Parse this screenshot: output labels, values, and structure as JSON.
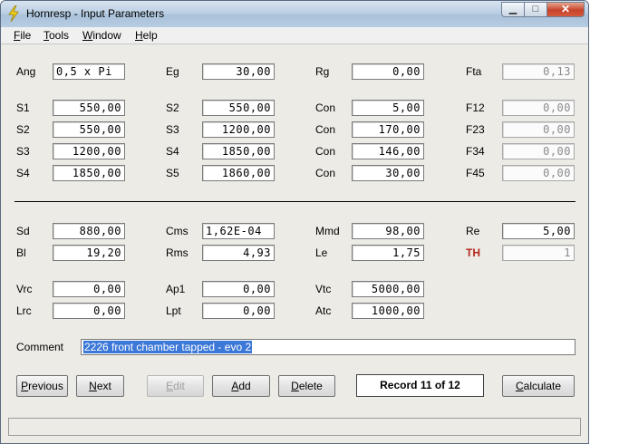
{
  "window": {
    "title": "Hornresp - Input Parameters",
    "min_glyph": "▁",
    "max_glyph": "□",
    "close_glyph": "✕"
  },
  "menu": [
    {
      "accel": "F",
      "rest": "ile"
    },
    {
      "accel": "T",
      "rest": "ools"
    },
    {
      "accel": "W",
      "rest": "indow"
    },
    {
      "accel": "H",
      "rest": "elp"
    }
  ],
  "rows": [
    [
      {
        "label": "Ang",
        "value": "0,5 x Pi",
        "align": "left"
      },
      {
        "label": "Eg",
        "value": "30,00"
      },
      {
        "label": "Rg",
        "value": "0,00"
      },
      {
        "label": "Fta",
        "value": "0,13",
        "readonly": true
      }
    ],
    [
      {
        "label": "S1",
        "value": "550,00"
      },
      {
        "label": "S2",
        "value": "550,00"
      },
      {
        "label": "Con",
        "value": "5,00"
      },
      {
        "label": "F12",
        "value": "0,00",
        "readonly": true
      }
    ],
    [
      {
        "label": "S2",
        "value": "550,00"
      },
      {
        "label": "S3",
        "value": "1200,00"
      },
      {
        "label": "Con",
        "value": "170,00"
      },
      {
        "label": "F23",
        "value": "0,00",
        "readonly": true
      }
    ],
    [
      {
        "label": "S3",
        "value": "1200,00"
      },
      {
        "label": "S4",
        "value": "1850,00"
      },
      {
        "label": "Con",
        "value": "146,00"
      },
      {
        "label": "F34",
        "value": "0,00",
        "readonly": true
      }
    ],
    [
      {
        "label": "S4",
        "value": "1850,00"
      },
      {
        "label": "S5",
        "value": "1860,00"
      },
      {
        "label": "Con",
        "value": "30,00"
      },
      {
        "label": "F45",
        "value": "0,00",
        "readonly": true
      }
    ],
    [
      {
        "label": "Sd",
        "value": "880,00"
      },
      {
        "label": "Cms",
        "value": "1,62E-04",
        "align": "left"
      },
      {
        "label": "Mmd",
        "value": "98,00"
      },
      {
        "label": "Re",
        "value": "5,00"
      }
    ],
    [
      {
        "label": "Bl",
        "value": "19,20"
      },
      {
        "label": "Rms",
        "value": "4,93"
      },
      {
        "label": "Le",
        "value": "1,75"
      },
      {
        "label": "TH",
        "value": "1",
        "readonly": true,
        "red": true
      }
    ],
    [
      {
        "label": "Vrc",
        "value": "0,00"
      },
      {
        "label": "Ap1",
        "value": "0,00"
      },
      {
        "label": "Vtc",
        "value": "5000,00"
      }
    ],
    [
      {
        "label": "Lrc",
        "value": "0,00"
      },
      {
        "label": "Lpt",
        "value": "0,00"
      },
      {
        "label": "Atc",
        "value": "1000,00"
      }
    ]
  ],
  "comment": {
    "label": "Comment",
    "value": "2226 front chamber tapped - evo 2"
  },
  "buttons": {
    "previous": {
      "accel": "P",
      "rest": "revious"
    },
    "next": {
      "accel": "N",
      "rest": "ext"
    },
    "edit": {
      "accel": "E",
      "rest": "dit"
    },
    "add": {
      "accel": "A",
      "rest": "dd"
    },
    "delete": {
      "accel": "D",
      "rest": "elete"
    },
    "calculate": {
      "accel": "C",
      "rest": "alculate"
    }
  },
  "record": "Record 11 of 12",
  "colors": {
    "accent_red": "#b4281e",
    "selection": "#3c78d8"
  }
}
